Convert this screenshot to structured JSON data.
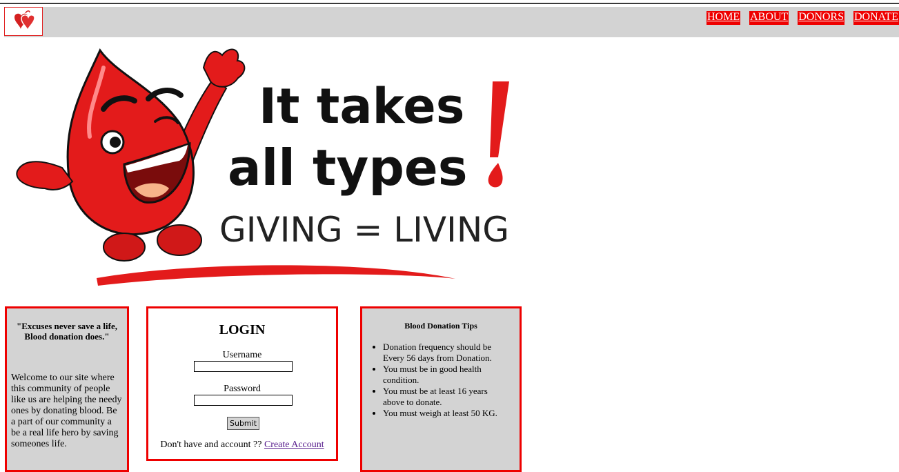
{
  "nav": {
    "links": [
      "HOME",
      "ABOUT",
      "DONORS",
      "DONATE"
    ]
  },
  "banner": {
    "line1": "It takes",
    "line2": "all types",
    "line3": "GIVING = LIVING"
  },
  "left_box": {
    "quote": "\"Excuses never save a life, Blood donation does.\"",
    "welcome": "Welcome to our site where this community of people like us are helping the needy ones by donating blood. Be a part of our community a be a real life hero by saving someones life."
  },
  "login": {
    "title": "LOGIN",
    "username_label": "Username",
    "username_value": "",
    "password_label": "Password",
    "password_value": "",
    "submit_label": "Submit",
    "no_account_text": "Don't have and account ??",
    "create_account_link": "Create Account"
  },
  "tips_box": {
    "title": "Blood Donation Tips",
    "items": [
      "Donation frequency should be Every 56 days from Donation.",
      "You must be in good health condition.",
      "You must be at least 16 years above to donate.",
      "You must weigh at least 50 KG."
    ]
  },
  "colors": {
    "accent": "#ee0000",
    "panel": "#d3d3d3",
    "link_visited": "#551a8b"
  }
}
